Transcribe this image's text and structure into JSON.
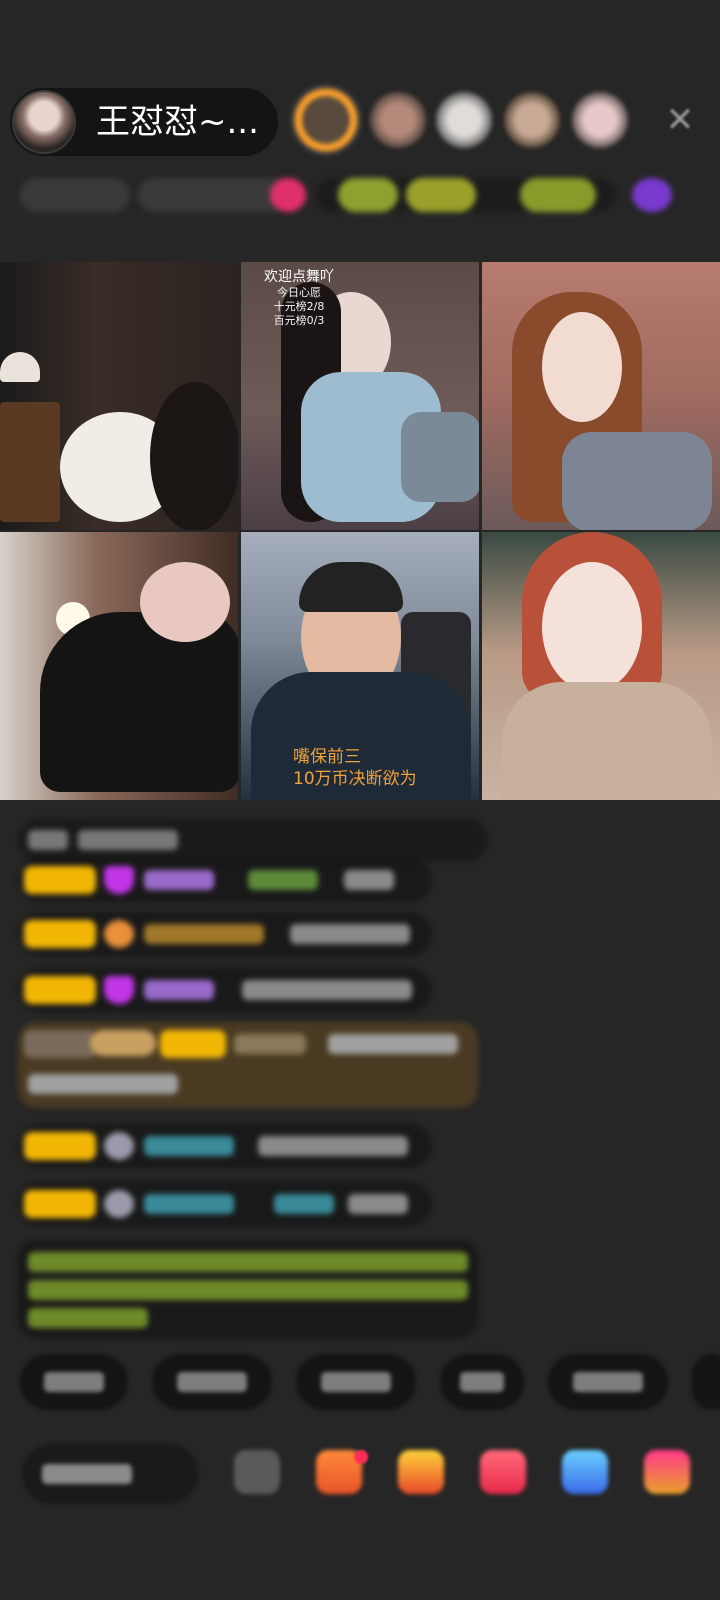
{
  "header": {
    "host_name": "王怼怼~...",
    "close_symbol": "✕"
  },
  "tile_overlays": {
    "wish_title": "欢迎点舞吖",
    "wish_subtitle": "今日心愿",
    "wish_line_1": "十元榜2/8",
    "wish_line_2": "百元榜0/3",
    "caption_line_1": "嘴保前三",
    "caption_line_2": "10万币决断欲为"
  },
  "colors": {
    "badge_yellow": "#f2b705",
    "caption_orange": "#f0a13a",
    "background": "#262626"
  },
  "icons": {
    "close": "close-icon",
    "gift": "gift-icon",
    "diamond": "diamond-icon"
  }
}
